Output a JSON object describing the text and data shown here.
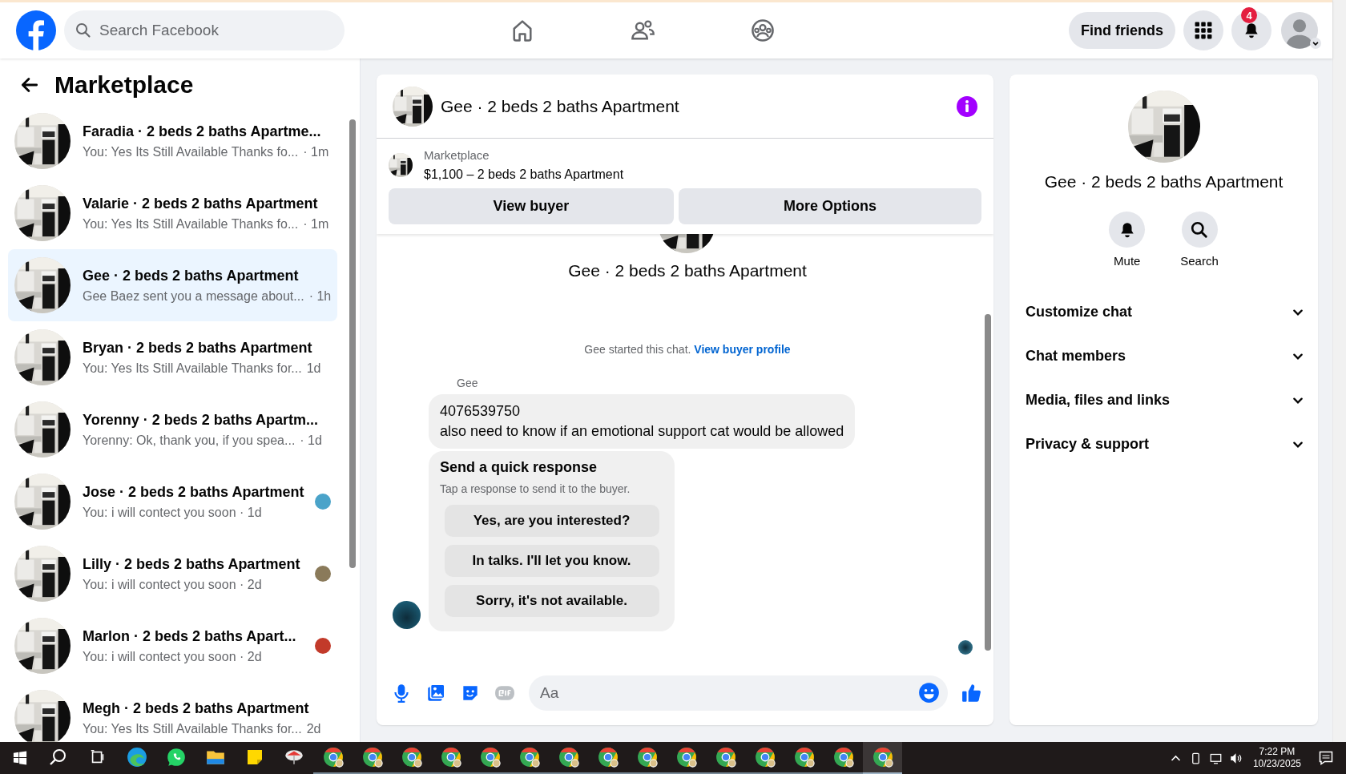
{
  "top_bar": {
    "search": {
      "placeholder": "Search Facebook"
    },
    "find_friends": "Find friends",
    "notification_count": "4"
  },
  "sidebar": {
    "title": "Marketplace",
    "conversations": [
      {
        "name": "Faradia · 2 beds 2 baths Apartme...",
        "snippet": "You: Yes Its Still Available Thanks fo...",
        "time": "· 1m",
        "selected": false,
        "seen": false
      },
      {
        "name": "Valarie · 2 beds 2 baths Apartment",
        "snippet": "You: Yes Its Still Available Thanks fo...",
        "time": "· 1m",
        "selected": false,
        "seen": false
      },
      {
        "name": "Gee · 2 beds 2 baths Apartment",
        "snippet": "Gee Baez sent you a message about...",
        "time": "· 1h",
        "selected": true,
        "seen": false
      },
      {
        "name": "Bryan · 2 beds 2 baths Apartment",
        "snippet": "You: Yes Its Still Available Thanks for...",
        "time": "1d",
        "selected": false,
        "seen": false
      },
      {
        "name": "Yorenny · 2 beds 2 baths Apartm...",
        "snippet": "Yorenny: Ok, thank you, if you spea...",
        "time": "· 1d",
        "selected": false,
        "seen": false
      },
      {
        "name": "Jose · 2 beds 2 baths Apartment",
        "snippet": "You: i will contect you soon · 1d",
        "selected": false,
        "seen": true,
        "color": "#4aa3c9"
      },
      {
        "name": "Lilly · 2 beds 2 baths Apartment",
        "snippet": "You: i will contect you soon · 2d",
        "selected": false,
        "seen": true,
        "color": "#8a7a5a"
      },
      {
        "name": "Marlon · 2 beds 2 baths Apart...",
        "snippet": "You: i will contect you soon · 2d",
        "selected": false,
        "seen": true,
        "color": "#c23a2a"
      },
      {
        "name": "Megh · 2 beds 2 baths Apartment",
        "snippet": "You: Yes Its Still Available Thanks for...",
        "time": "2d",
        "selected": false,
        "seen": false
      }
    ]
  },
  "chat": {
    "title": "Gee · 2 beds 2 baths Apartment",
    "listing": {
      "label": "Marketplace",
      "text": "$1,100 – 2 beds 2 baths Apartment"
    },
    "buttons": [
      "View buyer",
      "More Options"
    ],
    "intro_name": "Gee · 2 beds 2 baths Apartment",
    "started": {
      "text": "Gee started this chat.",
      "link": "View buyer profile"
    },
    "sender": "Gee",
    "message_lines": [
      "4076539750",
      "also need to know if an emotional support cat would be allowed"
    ],
    "quick_response": {
      "title": "Send a quick response",
      "subtitle": "Tap a response to send it to the buyer.",
      "options": [
        "Yes, are you interested?",
        "In talks. I'll let you know.",
        "Sorry, it's not available."
      ]
    },
    "composer": {
      "placeholder": "Aa"
    }
  },
  "details": {
    "title": "Gee · 2 beds 2 baths Apartment",
    "actions": [
      {
        "kind": "mute",
        "label": "Mute"
      },
      {
        "kind": "search",
        "label": "Search"
      }
    ],
    "sections": [
      {
        "label": "Customize chat",
        "expanded": false
      },
      {
        "label": "Chat members",
        "expanded": false
      },
      {
        "label": "Media, files and links",
        "expanded": false
      },
      {
        "label": "Privacy & support",
        "expanded": false
      }
    ]
  },
  "taskbar": {
    "apps": [
      {
        "kind": "search",
        "active": false
      },
      {
        "kind": "taskview",
        "active": false
      },
      {
        "kind": "edge",
        "active": false
      },
      {
        "kind": "whatsapp",
        "active": false
      },
      {
        "kind": "folder",
        "active": false
      },
      {
        "kind": "notes",
        "active": false
      },
      {
        "kind": "app",
        "active": false
      },
      {
        "kind": "chrome",
        "active": false
      },
      {
        "kind": "chrome",
        "active": false
      },
      {
        "kind": "chrome",
        "active": false
      },
      {
        "kind": "chrome",
        "active": false
      },
      {
        "kind": "chrome",
        "active": false
      },
      {
        "kind": "chrome",
        "active": false
      },
      {
        "kind": "chrome",
        "active": false
      },
      {
        "kind": "chrome",
        "active": false
      },
      {
        "kind": "chrome",
        "active": false
      },
      {
        "kind": "chrome",
        "active": false
      },
      {
        "kind": "chrome",
        "active": false
      },
      {
        "kind": "chrome",
        "active": false
      },
      {
        "kind": "chrome",
        "active": false
      },
      {
        "kind": "chrome",
        "active": false
      },
      {
        "kind": "chrome",
        "active": true
      }
    ],
    "time": "7:22 PM",
    "date": "10/23/2025"
  }
}
